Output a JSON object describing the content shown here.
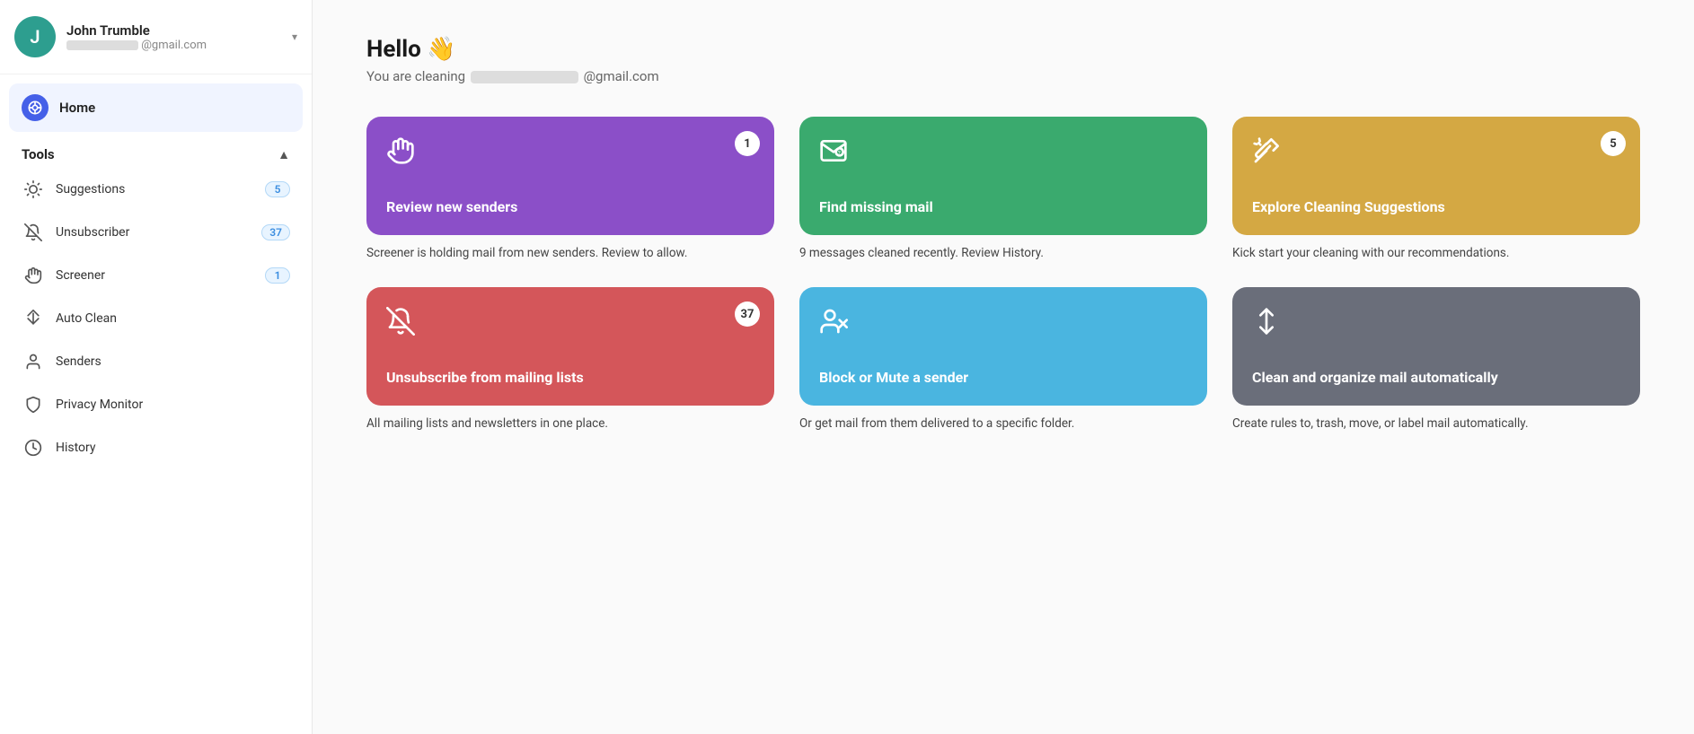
{
  "sidebar": {
    "user": {
      "name": "John Trumble",
      "email": "@gmail.com",
      "avatar_letter": "J"
    },
    "home": {
      "label": "Home"
    },
    "tools_section": {
      "label": "Tools",
      "items": [
        {
          "id": "suggestions",
          "label": "Suggestions",
          "badge": "5",
          "icon": "bulb"
        },
        {
          "id": "unsubscriber",
          "label": "Unsubscriber",
          "badge": "37",
          "icon": "bell-off"
        },
        {
          "id": "screener",
          "label": "Screener",
          "badge": "1",
          "icon": "hand"
        },
        {
          "id": "auto-clean",
          "label": "Auto Clean",
          "badge": "",
          "icon": "arrows-down-up"
        },
        {
          "id": "senders",
          "label": "Senders",
          "badge": "",
          "icon": "person"
        },
        {
          "id": "privacy-monitor",
          "label": "Privacy Monitor",
          "badge": "",
          "icon": "shield"
        },
        {
          "id": "history",
          "label": "History",
          "badge": "",
          "icon": "clock"
        }
      ]
    }
  },
  "main": {
    "greeting": "Hello 👋",
    "subgreeting_prefix": "You are cleaning",
    "subgreeting_suffix": "@gmail.com",
    "cards": [
      {
        "id": "review-senders",
        "color_class": "card-purple",
        "title": "Review new senders",
        "badge": "1",
        "description": "Screener is holding mail from new senders. Review to allow.",
        "icon": "hand"
      },
      {
        "id": "find-missing",
        "color_class": "card-green",
        "title": "Find missing mail",
        "badge": "",
        "description": "9 messages cleaned recently. Review History.",
        "icon": "envelope-question"
      },
      {
        "id": "explore-suggestions",
        "color_class": "card-orange",
        "title": "Explore Cleaning Suggestions",
        "badge": "5",
        "description": "Kick start your cleaning with our recommendations.",
        "icon": "broom-sparkle"
      },
      {
        "id": "unsubscribe",
        "color_class": "card-red",
        "title": "Unsubscribe from mailing lists",
        "badge": "37",
        "description": "All mailing lists and newsletters in one place.",
        "icon": "bell-off"
      },
      {
        "id": "block-mute",
        "color_class": "card-blue",
        "title": "Block or Mute a sender",
        "badge": "",
        "description": "Or get mail from them delivered to a specific folder.",
        "icon": "person-block"
      },
      {
        "id": "auto-clean-card",
        "color_class": "card-gray",
        "title": "Clean and organize mail automatically",
        "badge": "",
        "description": "Create rules to, trash, move, or label mail automatically.",
        "icon": "arrows-updown"
      }
    ]
  }
}
